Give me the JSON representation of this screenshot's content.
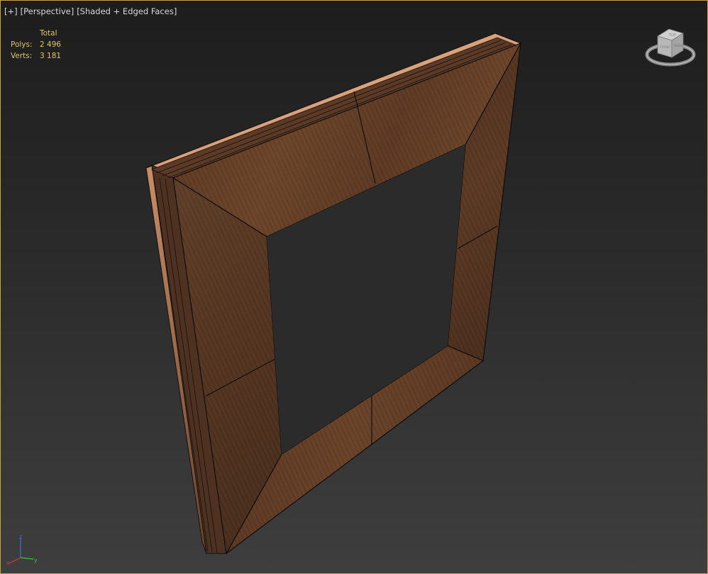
{
  "viewport": {
    "menu": {
      "plus": "[+]",
      "view": "[Perspective]",
      "shading": "[Shaded + Edged Faces]"
    },
    "stats": {
      "header": "Total",
      "polys_label": "Polys:",
      "polys_value": "2 496",
      "verts_label": "Verts:",
      "verts_value": "3 181"
    },
    "viewcube": {
      "top_label": "TOP",
      "front_label": "FRONT",
      "right_label": "RIGHT"
    },
    "axis": {
      "x": "x",
      "y": "y",
      "z": "z"
    }
  },
  "colors": {
    "frame_border": "#c6a34a",
    "stats_text": "#e4c464",
    "wood_dark": "#4a2e1d",
    "wood_mid": "#6b4329",
    "wood_edge": "#d9a07a",
    "axis_x": "#d23c3c",
    "axis_y": "#3fc23f",
    "axis_z": "#4a6ad8"
  },
  "icons": [
    "viewcube-icon",
    "axis-tripod-icon"
  ]
}
